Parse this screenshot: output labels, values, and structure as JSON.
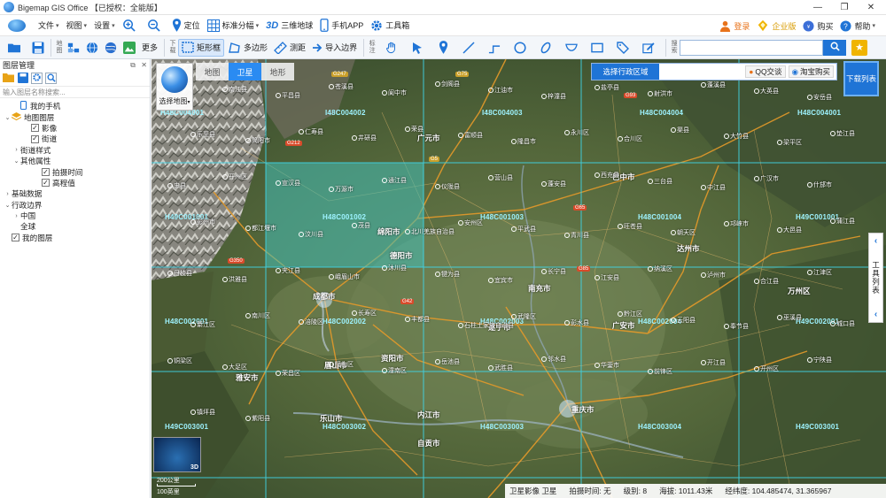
{
  "window": {
    "title": "Bigemap GIS Office 【已授权：全能版】",
    "controls": [
      "—",
      "❐",
      "✕"
    ]
  },
  "menu": {
    "file": "文件",
    "view": "视图",
    "settings": "设置",
    "locate": "定位",
    "std_grid": "标准分幅",
    "three_d_label": "3D",
    "three_d": "三维地球",
    "mobile": "手机APP",
    "toolbox": "工具箱",
    "login": "登录",
    "enterprise": "企业版",
    "buy": "购买",
    "help": "帮助"
  },
  "toolbar": {
    "group_map": "地图",
    "more": "更多",
    "group_download": "下载",
    "rect": "矩形框",
    "polygon": "多边形",
    "measure": "测距",
    "import_border": "导入边界",
    "group_mark": "标注",
    "group_search": "搜索",
    "search_placeholder": ""
  },
  "layer_panel": {
    "title": "图层管理",
    "search_placeholder": "输入图层名称搜索...",
    "tree": [
      {
        "label": "我的手机",
        "level": 1,
        "expander": "",
        "checkbox": null,
        "icon": "phone"
      },
      {
        "label": "地图图层",
        "level": 0,
        "expander": "⌄",
        "checkbox": null,
        "icon": "layers"
      },
      {
        "label": "影像",
        "level": 2,
        "expander": "",
        "checkbox": true
      },
      {
        "label": "街道",
        "level": 2,
        "expander": "",
        "checkbox": true
      },
      {
        "label": "街道样式",
        "level": 1,
        "expander": "›",
        "checkbox": null
      },
      {
        "label": "其他属性",
        "level": 1,
        "expander": "⌄",
        "checkbox": null
      },
      {
        "label": "拍摄时间",
        "level": 3,
        "expander": "",
        "checkbox": true
      },
      {
        "label": "高程值",
        "level": 3,
        "expander": "",
        "checkbox": true
      },
      {
        "label": "基础数据",
        "level": 0,
        "expander": "›",
        "checkbox": null
      },
      {
        "label": "行政边界",
        "level": 0,
        "expander": "⌄",
        "checkbox": null
      },
      {
        "label": "中国",
        "level": 1,
        "expander": "›",
        "checkbox": null
      },
      {
        "label": "全球",
        "level": 1,
        "expander": "",
        "checkbox": null
      },
      {
        "label": "我的图层",
        "level": 0,
        "expander": "",
        "checkbox": true
      }
    ]
  },
  "map": {
    "tabs": [
      "地图",
      "卫星",
      "地形"
    ],
    "active_tab": "卫星",
    "select_map": "选择地图",
    "region_select": "选择行政区域",
    "qq_chat": "QQ交谈",
    "taobao": "淘宝购买",
    "download_list": "下载列表",
    "tools_list": "工具列表",
    "grid_labels": [
      "H48C004001",
      "I48C004002",
      "I48C004003",
      "H48C004004",
      "H48C004001",
      "H49C001001",
      "H48C001002",
      "H48C001003",
      "H48C001004",
      "H49C001001",
      "H48C002001",
      "H48C002002",
      "H48C002003",
      "H48C002004",
      "H49C002001",
      "H49C003001",
      "H48C003002",
      "H48C003003",
      "H48C003004",
      "H49C003001"
    ],
    "cities": [
      "成都市",
      "遂宁市",
      "南充市",
      "达州市",
      "巴中市",
      "绵阳市",
      "德阳市",
      "广安市",
      "重庆市",
      "资阳市",
      "内江市",
      "自贡市",
      "乐山市",
      "眉山市",
      "雅安市",
      "广元市",
      "万州区"
    ],
    "places": [
      "宁强县",
      "南江县",
      "平昌县",
      "苍溪县",
      "阆中市",
      "剑阁县",
      "江油市",
      "梓潼县",
      "盐亭县",
      "射洪市",
      "蓬溪县",
      "大英县",
      "安岳县",
      "乐至县",
      "简阳市",
      "仁寿县",
      "井研县",
      "荣县",
      "富顺县",
      "隆昌市",
      "永川区",
      "合川区",
      "渠县",
      "大竹县",
      "梁平区",
      "垫江县",
      "忠县",
      "开州区",
      "宣汉县",
      "万源市",
      "通江县",
      "仪陇县",
      "营山县",
      "蓬安县",
      "西充县",
      "三台县",
      "中江县",
      "广汉市",
      "什邡市",
      "彭州市",
      "都江堰市",
      "汶川县",
      "茂县",
      "北川羌族自治县",
      "安州区",
      "平武县",
      "青川县",
      "旺苍县",
      "朝天区",
      "邛崃市",
      "大邑县",
      "蒲江县",
      "丹棱县",
      "洪雅县",
      "夹江县",
      "峨眉山市",
      "沐川县",
      "犍为县",
      "宜宾市",
      "长宁县",
      "江安县",
      "纳溪区",
      "泸州市",
      "合江县",
      "江津区",
      "綦江区",
      "南川区",
      "涪陵区",
      "长寿区",
      "丰都县",
      "石柱土家族自治县",
      "武隆区",
      "彭水县",
      "黔江区",
      "云阳县",
      "奉节县",
      "巫溪县",
      "城口县",
      "铜梁区",
      "大足区",
      "荣昌区",
      "璧山区",
      "潼南区",
      "岳池县",
      "武胜县",
      "邻水县",
      "华蓥市",
      "前锋区",
      "开江县",
      "开州区",
      "宁陕县",
      "镇坪县",
      "紫阳县"
    ],
    "highways": [
      "G247",
      "G75",
      "G5",
      "G212",
      "G42",
      "G93",
      "G65",
      "G85",
      "G350"
    ],
    "scale_top": "200公里",
    "scale_bottom": "100英里",
    "minimap_label": "3D",
    "status": {
      "layer": "卫星影像 卫星",
      "capture_time": "拍摄时间: 无",
      "level": "级别: 8",
      "altitude": "海拔: 1011.43米",
      "lonlat": "经纬度: 104.485474, 31.365967"
    }
  },
  "colors": {
    "accent": "#1f74d6",
    "grid": "#3fd5e8",
    "selected_tile": "#43c0b8",
    "road": "#e59a2a"
  }
}
